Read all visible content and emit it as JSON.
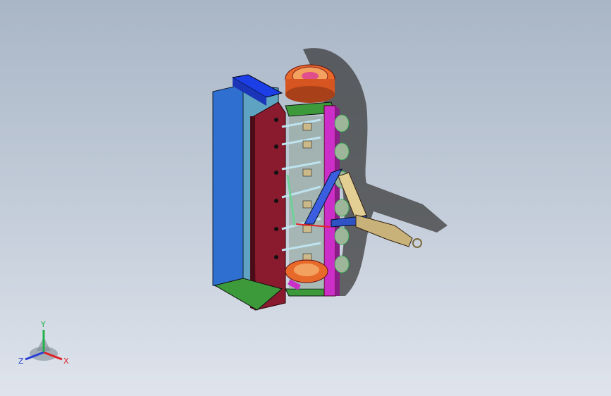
{
  "triad": {
    "x_label": "X",
    "y_label": "Y",
    "z_label": "Z",
    "x_color": "#e0232a",
    "y_color": "#21b34a",
    "z_color": "#2a3fd4"
  },
  "model": {
    "description_icon": "flail-mower-3d-model",
    "colors": {
      "hood_blue": "#2f6fd0",
      "hood_cyan": "#5fa3c2",
      "side_red": "#8a1b2e",
      "frame_magenta": "#cc2fc8",
      "pulley_orange": "#e86a2a",
      "base_green": "#3d9a3a",
      "arm_tan": "#c8b27a",
      "shadow": "#3a3a3a"
    }
  }
}
